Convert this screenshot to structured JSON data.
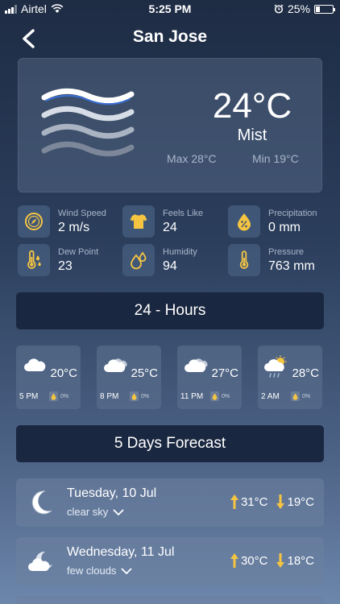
{
  "status_bar": {
    "carrier": "Airtel",
    "time": "5:25 PM",
    "battery": "25%",
    "battery_level": 0.25
  },
  "header": {
    "city": "San Jose"
  },
  "current": {
    "temperature": "24°C",
    "condition": "Mist",
    "max": "Max 28°C",
    "min": "Min 19°C"
  },
  "stats": [
    {
      "label": "Wind Speed",
      "value": "2 m/s",
      "icon": "compass-icon"
    },
    {
      "label": "Feels Like",
      "value": "24",
      "icon": "tshirt-icon"
    },
    {
      "label": "Precipitation",
      "value": "0 mm",
      "icon": "percent-drop-icon"
    },
    {
      "label": "Dew Point",
      "value": "23",
      "icon": "thermometer-drops-icon"
    },
    {
      "label": "Humidity",
      "value": "94",
      "icon": "drops-icon"
    },
    {
      "label": "Pressure",
      "value": "763 mm",
      "icon": "thermometer-icon"
    }
  ],
  "hourly_title": "24 - Hours",
  "hourly": [
    {
      "time": "5 PM",
      "temp": "20°C",
      "rain": "0%",
      "icon": "cloud-icon"
    },
    {
      "time": "8 PM",
      "temp": "25°C",
      "rain": "0%",
      "icon": "clouds-icon"
    },
    {
      "time": "11 PM",
      "temp": "27°C",
      "rain": "0%",
      "icon": "clouds-icon"
    },
    {
      "time": "2 AM",
      "temp": "28°C",
      "rain": "0%",
      "icon": "sun-cloud-rain-icon"
    }
  ],
  "forecast_title": "5 Days Forecast",
  "daily": [
    {
      "day": "Tuesday, 10 Jul",
      "desc": "clear sky",
      "high": "31°C",
      "low": "19°C",
      "icon": "moon-icon"
    },
    {
      "day": "Wednesday, 11 Jul",
      "desc": "few clouds",
      "high": "30°C",
      "low": "18°C",
      "icon": "moon-cloud-icon"
    }
  ],
  "colors": {
    "accent_yellow": "#f5c542",
    "banner": "#1a2740"
  }
}
